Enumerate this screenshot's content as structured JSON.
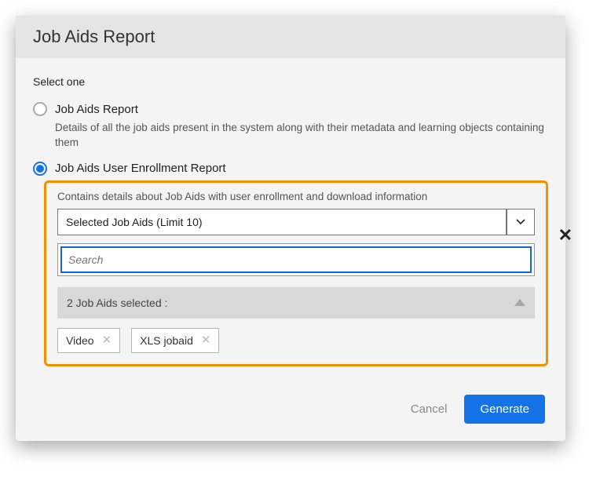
{
  "header": {
    "title": "Job Aids Report"
  },
  "body": {
    "section_label": "Select one",
    "options": [
      {
        "label": "Job Aids Report",
        "description": "Details of all the job aids present in the system along with their metadata and learning objects containing them",
        "selected": false
      },
      {
        "label": "Job Aids User Enrollment Report",
        "description": "Contains details about Job Aids with user enrollment and download information",
        "selected": true
      }
    ],
    "selector": {
      "selected_label": "Selected Job Aids (Limit 10)",
      "search_placeholder": "Search",
      "selected_count_text": "2 Job Aids selected :",
      "chips": [
        "Video",
        "XLS jobaid"
      ]
    }
  },
  "footer": {
    "cancel": "Cancel",
    "generate": "Generate"
  }
}
